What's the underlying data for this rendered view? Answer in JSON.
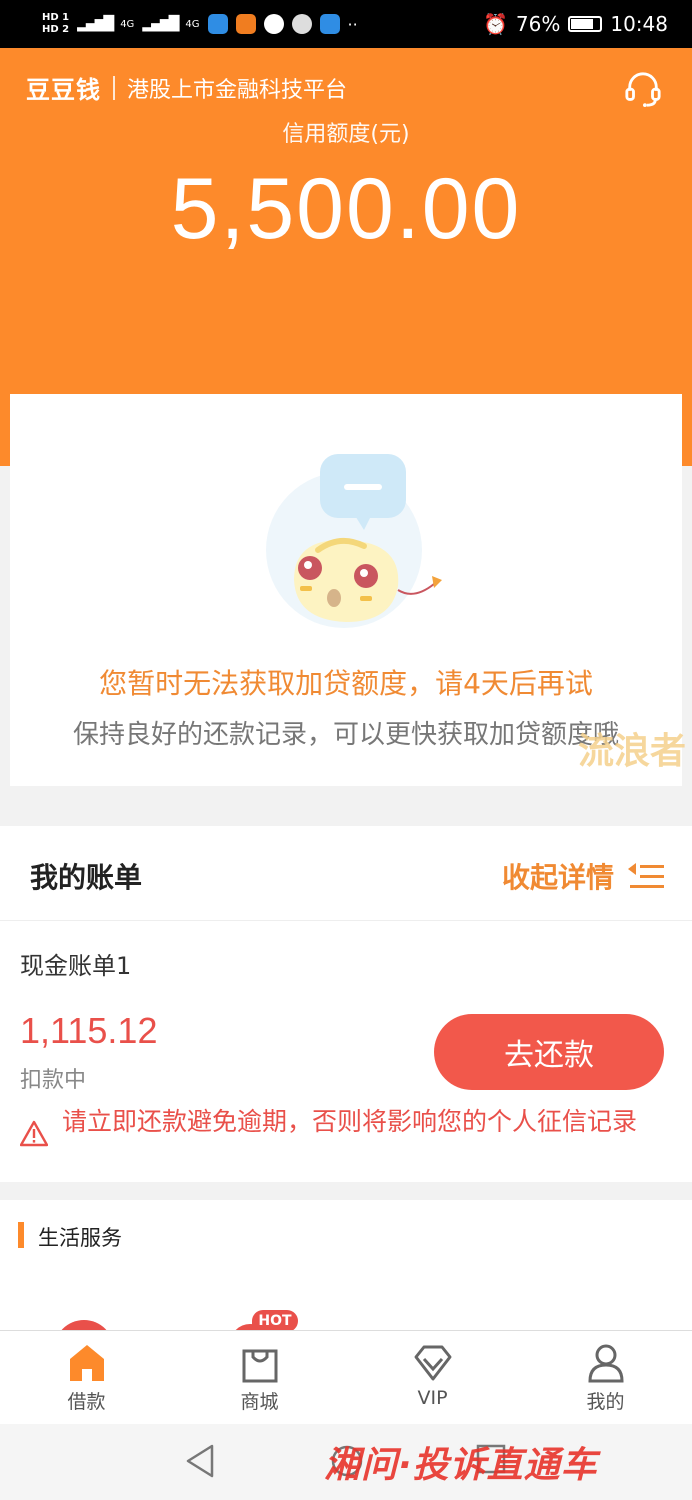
{
  "status_bar": {
    "hd1": "HD 1",
    "hd2": "HD 2",
    "network1": "4G",
    "network2": "4G",
    "battery_percent": "76%",
    "time": "10:48"
  },
  "header": {
    "brand_logo": "豆豆钱",
    "brand_slogan": "港股上市金融科技平台",
    "credit_label": "信用额度(元)",
    "credit_amount": "5,500.00",
    "headset_icon": "headset-icon"
  },
  "notice": {
    "title": "您暂时无法获取加贷额度，请4天后再试",
    "subtitle": "保持良好的还款记录，可以更快获取加贷额度哦"
  },
  "watermarks": {
    "top": "流浪者",
    "bottom": "湘问·投诉直通车"
  },
  "bills": {
    "title": "我的账单",
    "collapse_label": "收起详情",
    "items": [
      {
        "name": "现金账单1",
        "amount": "1,115.12",
        "status": "扣款中",
        "button_label": "去还款",
        "warning": "请立即还款避免逾期，否则将影响您的个人征信记录"
      }
    ]
  },
  "life_services": {
    "title": "生活服务",
    "hot_badge": "HOT"
  },
  "tabbar": {
    "items": [
      {
        "label": "借款",
        "icon": "home-icon",
        "active": true
      },
      {
        "label": "商城",
        "icon": "shopping-bag-icon",
        "active": false
      },
      {
        "label": "VIP",
        "icon": "diamond-icon",
        "active": false
      },
      {
        "label": "我的",
        "icon": "user-icon",
        "active": false
      }
    ]
  },
  "colors": {
    "accent": "#fd8a2b",
    "danger": "#e9504a",
    "button": "#f2584b"
  }
}
